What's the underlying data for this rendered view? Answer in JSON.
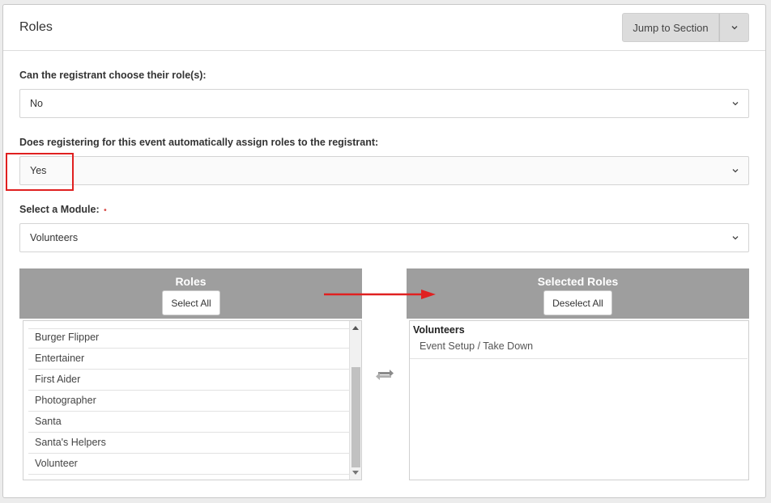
{
  "header": {
    "title": "Roles",
    "jump_label": "Jump to Section"
  },
  "fields": {
    "choose_role": {
      "label": "Can the registrant choose their role(s):",
      "value": "No"
    },
    "auto_assign": {
      "label": "Does registering for this event automatically assign roles to the registrant:",
      "value": "Yes"
    },
    "module": {
      "label": "Select a Module:",
      "required_mark": "•",
      "value": "Volunteers"
    }
  },
  "roles_list": {
    "title": "Roles",
    "select_all_label": "Select All",
    "items": [
      "Burger Flipper",
      "Entertainer",
      "First Aider",
      "Photographer",
      "Santa",
      "Santa's Helpers",
      "Volunteer"
    ]
  },
  "selected_list": {
    "title": "Selected Roles",
    "deselect_all_label": "Deselect All",
    "group": "Volunteers",
    "items": [
      "Event Setup / Take Down"
    ]
  },
  "colors": {
    "header_gray": "#9e9e9e",
    "annotation_red": "#e02020"
  }
}
